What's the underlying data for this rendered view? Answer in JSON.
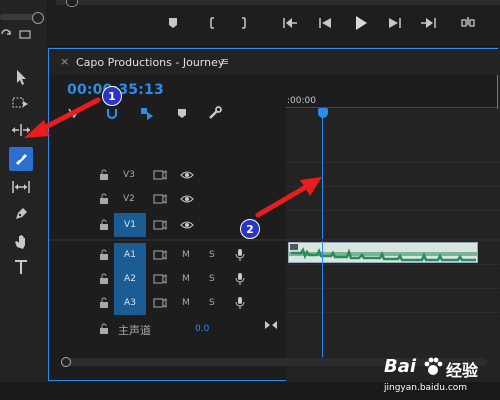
{
  "panel": {
    "close_glyph": "×",
    "title": "Capo Productions - Journey",
    "menu_glyph": "≡",
    "timecode": "00:00:35:13",
    "ruler_label": ":00:00"
  },
  "tracks": {
    "video": [
      {
        "name": "V3",
        "targeted": false
      },
      {
        "name": "V2",
        "targeted": false
      },
      {
        "name": "V1",
        "targeted": true
      }
    ],
    "audio": [
      {
        "name": "A1",
        "m": "M",
        "s": "S"
      },
      {
        "name": "A2",
        "m": "M",
        "s": "S"
      },
      {
        "name": "A3",
        "m": "M",
        "s": "S"
      }
    ],
    "master": {
      "name": "主声道",
      "value": "0.0"
    }
  },
  "annotations": {
    "bubble1": "1",
    "bubble2": "2"
  },
  "tools": [
    "selection-tool",
    "track-select-tool",
    "ripple-edit-tool",
    "razor-tool",
    "slip-tool",
    "pen-tool",
    "hand-tool",
    "type-tool"
  ],
  "watermark": {
    "brand": "Bai",
    "brand2": "经验",
    "url": "jingyan.baidu.com"
  },
  "colors": {
    "accent": "#2d8ceb",
    "target": "#1c5c95",
    "arrow": "#e81d1d",
    "bubble": "#2a35c8",
    "clip_audio": "#2e8a5c"
  }
}
